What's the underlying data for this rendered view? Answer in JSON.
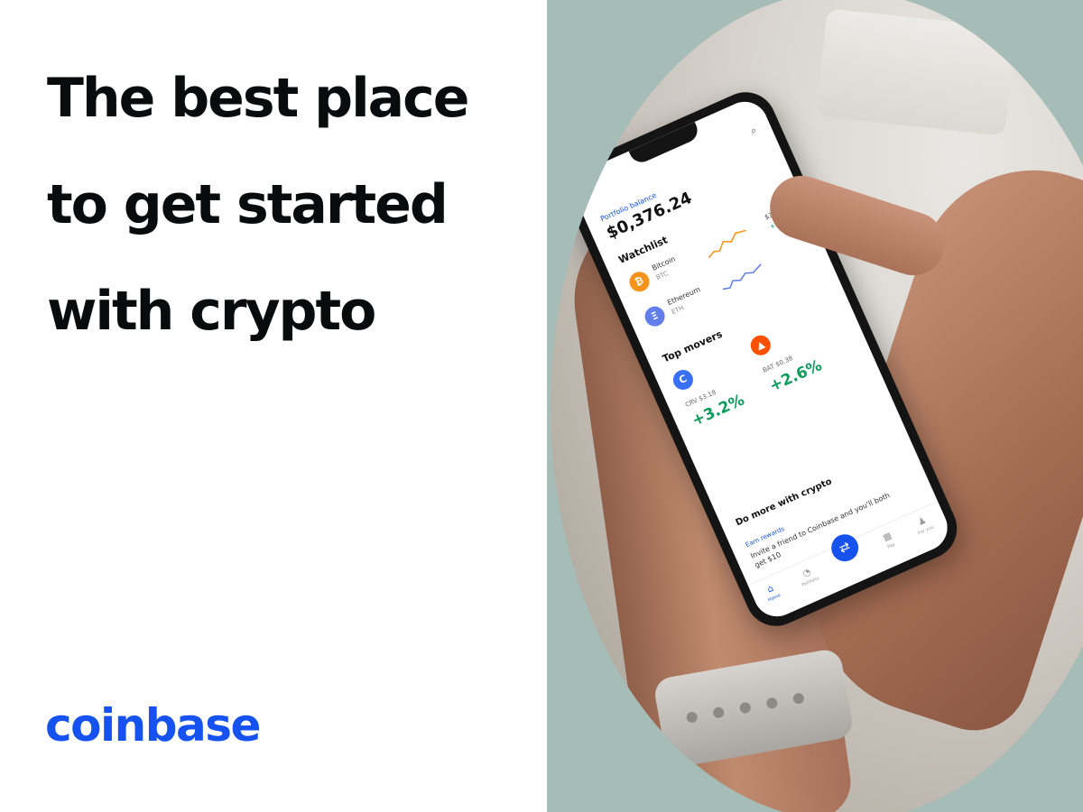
{
  "headline": {
    "line1": "The best place",
    "line2": "to get started",
    "line3": "with crypto"
  },
  "brand": {
    "logo_text": "coinbase",
    "color": "#1652f0"
  },
  "phone_screen": {
    "search_icon": "search-icon",
    "balance_label": "Portfolio balance",
    "balance": "$0,376.24",
    "watchlist_title": "Watchlist",
    "watchlist": [
      {
        "name": "Bitcoin",
        "ticker": "BTC",
        "price": "$37,052",
        "change": "+0.58%",
        "icon": "bitcoin-icon",
        "color": "#f7931a",
        "symbol": "₿"
      },
      {
        "name": "Ethereum",
        "ticker": "ETH",
        "price": "",
        "change": "",
        "icon": "ethereum-icon",
        "color": "#627eea",
        "symbol": "Ξ"
      }
    ],
    "top_movers_title": "Top movers",
    "top_movers": [
      {
        "ticker": "CRV $3.18",
        "change": "+3.2%",
        "color": "#3a6ff7",
        "symbol": "C"
      },
      {
        "ticker": "BAT $0.38",
        "change": "+2.6%",
        "color": "#ff5000",
        "symbol": "▲"
      }
    ],
    "promo_title": "Do more with crypto",
    "promo_tag": "Earn rewards",
    "promo_text": "Invite a friend to Coinbase and you'll both get $10",
    "tabs": [
      {
        "label": "Home",
        "icon": "home-icon",
        "glyph": "⌂"
      },
      {
        "label": "Portfolio",
        "icon": "portfolio-icon",
        "glyph": "◔"
      },
      {
        "label": "Trade",
        "icon": "trade-icon",
        "glyph": "⇄"
      },
      {
        "label": "Pay",
        "icon": "pay-icon",
        "glyph": "▦"
      },
      {
        "label": "For you",
        "icon": "profile-icon",
        "glyph": "♟"
      }
    ]
  }
}
